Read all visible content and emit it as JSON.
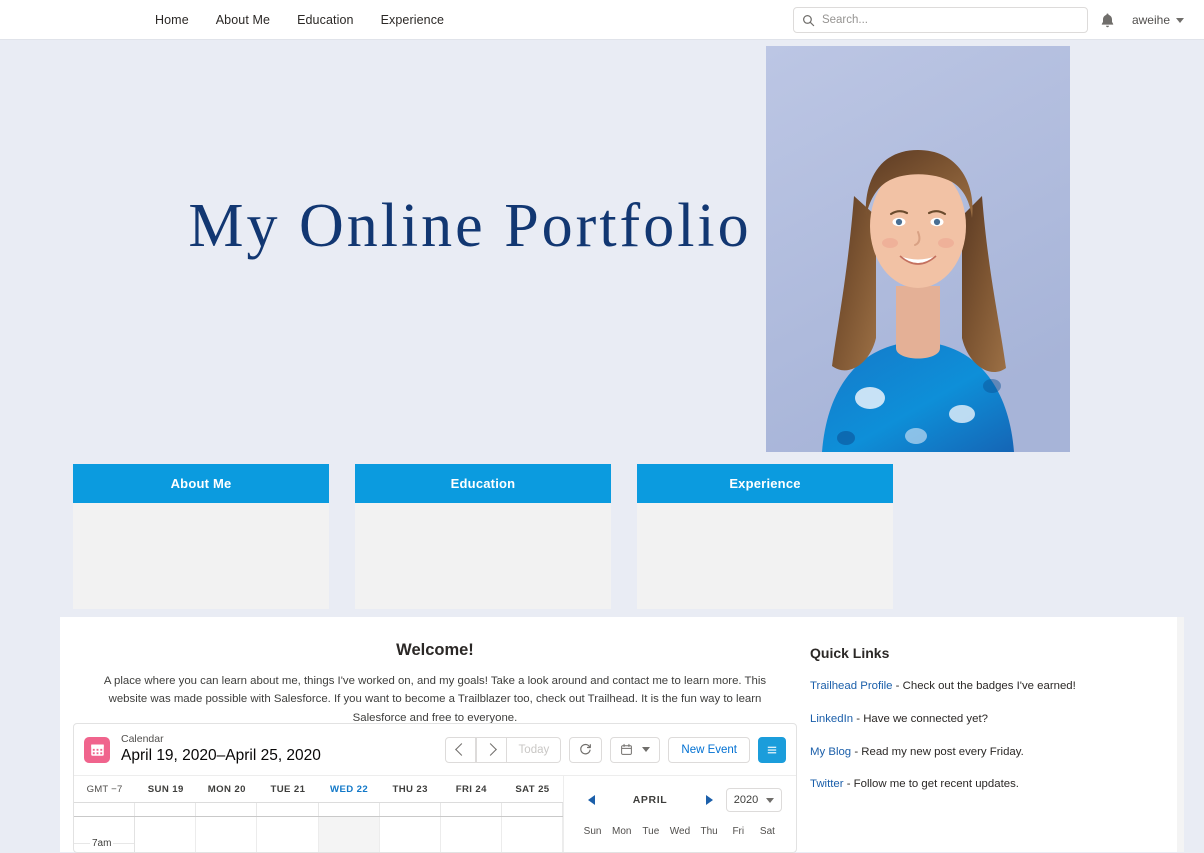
{
  "header": {
    "nav": [
      {
        "label": "Home"
      },
      {
        "label": "About Me"
      },
      {
        "label": "Education"
      },
      {
        "label": "Experience"
      }
    ],
    "search_placeholder": "Search...",
    "search_value": "",
    "search_icon": "search-icon",
    "notification_icon": "bell-icon",
    "user_name": "aweihe",
    "user_caret_icon": "chevron-down-icon"
  },
  "hero": {
    "title": "My Online  Portfolio",
    "photo_alt": "portrait-photo"
  },
  "cards": [
    {
      "title": "About Me"
    },
    {
      "title": "Education"
    },
    {
      "title": "Experience"
    }
  ],
  "welcome": {
    "title": "Welcome!",
    "body": "A place where you can learn about me, things I've worked on, and my goals! Take a look around and contact me to learn more. This website was made possible with Salesforce. If you want to become a Trailblazer too, check out Trailhead. It is the fun way to learn Salesforce and free to everyone."
  },
  "quick_links": {
    "title": "Quick Links",
    "items": [
      {
        "link": "Trailhead Profile",
        "rest": " - Check out the badges I've earned!"
      },
      {
        "link": "LinkedIn",
        "rest": " - Have we connected yet?"
      },
      {
        "link": "My Blog",
        "rest": " - Read my new post every Friday."
      },
      {
        "link": "Twitter",
        "rest": " - Follow me to get recent updates."
      }
    ]
  },
  "calendar": {
    "icon": "calendar-icon",
    "kicker": "Calendar",
    "range": "April 19, 2020–April 25, 2020",
    "prev_icon": "chevron-left-icon",
    "next_icon": "chevron-right-icon",
    "today_label": "Today",
    "refresh_icon": "refresh-icon",
    "view_icon": "calendar-view-icon",
    "view_caret_icon": "chevron-down-icon",
    "new_event_label": "New Event",
    "menu_icon": "hamburger-menu-icon",
    "timezone": "GMT −7",
    "days": [
      {
        "label": "SUN 19",
        "today": false
      },
      {
        "label": "MON 20",
        "today": false
      },
      {
        "label": "TUE 21",
        "today": false
      },
      {
        "label": "WED 22",
        "today": true
      },
      {
        "label": "THU 23",
        "today": false
      },
      {
        "label": "FRI 24",
        "today": false
      },
      {
        "label": "SAT 25",
        "today": false
      }
    ],
    "hour_label": "7am",
    "mini": {
      "prev_icon": "triangle-left-icon",
      "month": "APRIL",
      "next_icon": "triangle-right-icon",
      "year": "2020",
      "year_caret_icon": "chevron-down-icon",
      "dow": [
        "Sun",
        "Mon",
        "Tue",
        "Wed",
        "Thu",
        "Fri",
        "Sat"
      ]
    }
  },
  "colors": {
    "page_bg": "#e9ecf4",
    "card_header_blue": "#0b9bdf",
    "title_navy": "#123772",
    "link_blue": "#1b5faa",
    "calendar_pink": "#f0648d",
    "action_blue": "#0070d2"
  }
}
